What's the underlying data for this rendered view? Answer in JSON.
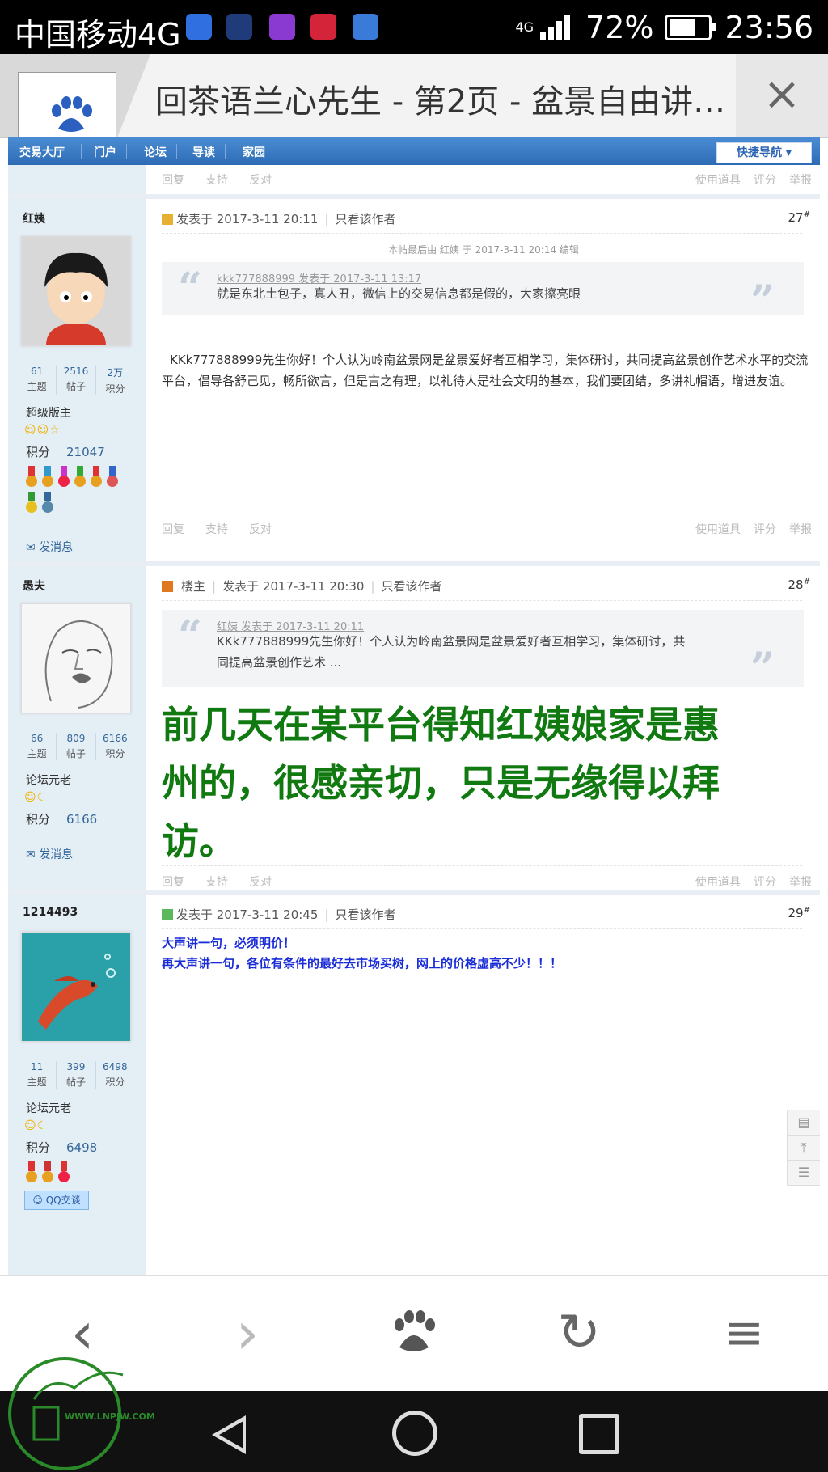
{
  "status_bar": {
    "carrier": "中国移动4G",
    "network": "4G",
    "battery": "72%",
    "battery_level": 0.72,
    "time": "23:56"
  },
  "browser": {
    "page_title": "回茶语兰心先生 - 第2页 - 盆景自由讲…",
    "close_icon": "×"
  },
  "nav": {
    "items": [
      "交易大厅",
      "门户",
      "论坛",
      "导读",
      "家园"
    ],
    "quick_nav": "快捷导航"
  },
  "actions": {
    "reply": "回复",
    "support": "支持",
    "oppose": "反对",
    "tools": "使用道具",
    "rate": "评分",
    "report": "举报"
  },
  "stats_labels": [
    "主题",
    "帖子",
    "积分"
  ],
  "points_label": "积分",
  "send_message": "发消息",
  "only_author": "只看该作者",
  "posts": [
    {
      "username": "红姨",
      "stats": [
        "61",
        "2516",
        "2万"
      ],
      "rank": "超级版主",
      "points": "21047",
      "posted": "发表于 2017-3-11 20:11",
      "floor": "27",
      "edit_note": "本帖最后由 红姨 于 2017-3-11 20:14 编辑",
      "quote_head": "kkk777888999 发表于 2017-3-11 13:17",
      "quote_body": "就是东北土包子，真人丑，微信上的交易信息都是假的，大家擦亮眼",
      "body": "KKk777888999先生你好！个人认为岭南盆景网是盆景爱好者互相学习，集体研讨，共同提高盆景创作艺术水平的交流平台，倡导各舒己见，畅所欲言，但是言之有理，以礼待人是社会文明的基本，我们要团结，多讲礼帽语，增进友谊。"
    },
    {
      "username": "愚夫",
      "stats": [
        "66",
        "809",
        "6166"
      ],
      "rank": "论坛元老",
      "points": "6166",
      "owner_label": "楼主",
      "posted": "发表于 2017-3-11 20:30",
      "floor": "28",
      "quote_head": "红姨 发表于 2017-3-11 20:11",
      "quote_body_1": "KKk777888999先生你好！个人认为岭南盆景网是盆景爱好者互相学习，集体研讨，共",
      "quote_body_2": "同提高盆景创作艺术 ...",
      "body": "前几天在某平台得知红姨娘家是惠州的，很感亲切，只是无缘得以拜访。"
    },
    {
      "username": "1214493",
      "stats": [
        "11",
        "399",
        "6498"
      ],
      "rank": "论坛元老",
      "points": "6498",
      "posted": "发表于 2017-3-11 20:45",
      "floor": "29",
      "body_1": "大声讲一句，必须明价！",
      "body_2": "再大声讲一句，各位有条件的最好去市场买树，网上的价格虚高不少！！！",
      "qq": "QQ交谈"
    }
  ],
  "watermark": {
    "url": "WWW.LNPJW.COM"
  },
  "colors": {
    "nav_blue": "#2d6cb5",
    "green_text": "#107a10",
    "blue_text": "#1a2cd8"
  }
}
